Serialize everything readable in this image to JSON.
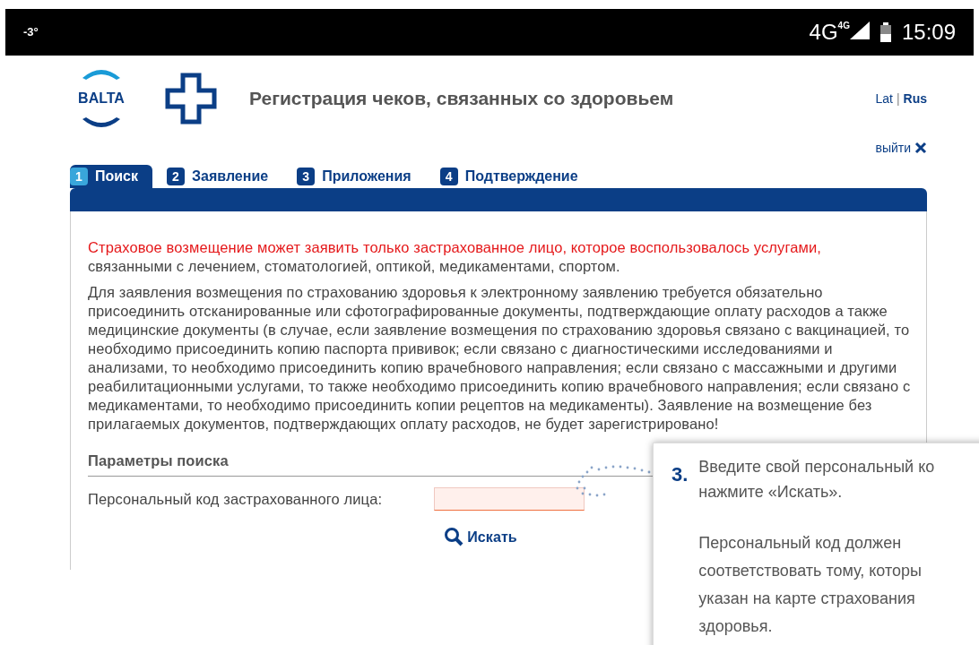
{
  "status_bar": {
    "temperature": "-3°",
    "network": "4G",
    "network_small": "4G",
    "time": "15:09"
  },
  "header": {
    "logo_text": "BALTA",
    "title": "Регистрация чеков, связанных со здоровьем",
    "separator": "|",
    "languages": [
      {
        "label": "Lat",
        "selected": false
      },
      {
        "label": "Rus",
        "selected": true
      }
    ],
    "logout": "выйти"
  },
  "tabs": [
    {
      "number": "1",
      "label": "Поиск",
      "selected": true
    },
    {
      "number": "2",
      "label": "Заявление",
      "selected": false
    },
    {
      "number": "3",
      "label": "Приложения",
      "selected": false
    },
    {
      "number": "4",
      "label": "Подтверждение",
      "selected": false
    }
  ],
  "notice": {
    "warning": "Страховое возмещение может заявить только застрахованное лицо, которое воспользовалось услугами,",
    "text": "связанными с лечением, стоматологией, оптикой, медикаментами, спортом."
  },
  "body_text": "Для заявления возмещения по страхованию здоровья к электронному заявлению требуется обязательно присоединить отсканированные или сфотографированные документы, подтверждающие оплату расходов а также медицинские документы (в случае, если заявление возмещения по страхованию здоровья связано с вакцинацией, то необходимо присоединить копию паспорта прививок; если связано с диагностическими исследованиями и анализами, то необходимо присоединить копию врачебнового направления; если связано с массажными и другими реабилитационными услугами, то также необходимо присоединить копию врачебнового направления; если связано с медикаментами, то необходимо присоединить копии рецептов на медикаменты). Заявление на возмещение без прилагаемых документов, подтверждающих оплату расходов, не будет зарегистрировано!",
  "search": {
    "heading": "Параметры поиска",
    "field_label": "Персональный код застрахованного лица:",
    "field_required": true,
    "button": "Искать"
  },
  "tooltip": {
    "step": "3.",
    "lines": [
      "Введите свой персональный ко",
      "нажмите «Искать»."
    ],
    "note_lines": [
      "Персональный код должен",
      "соответствовать тому, которы",
      "указан на карте страхования",
      "здоровья."
    ]
  }
}
